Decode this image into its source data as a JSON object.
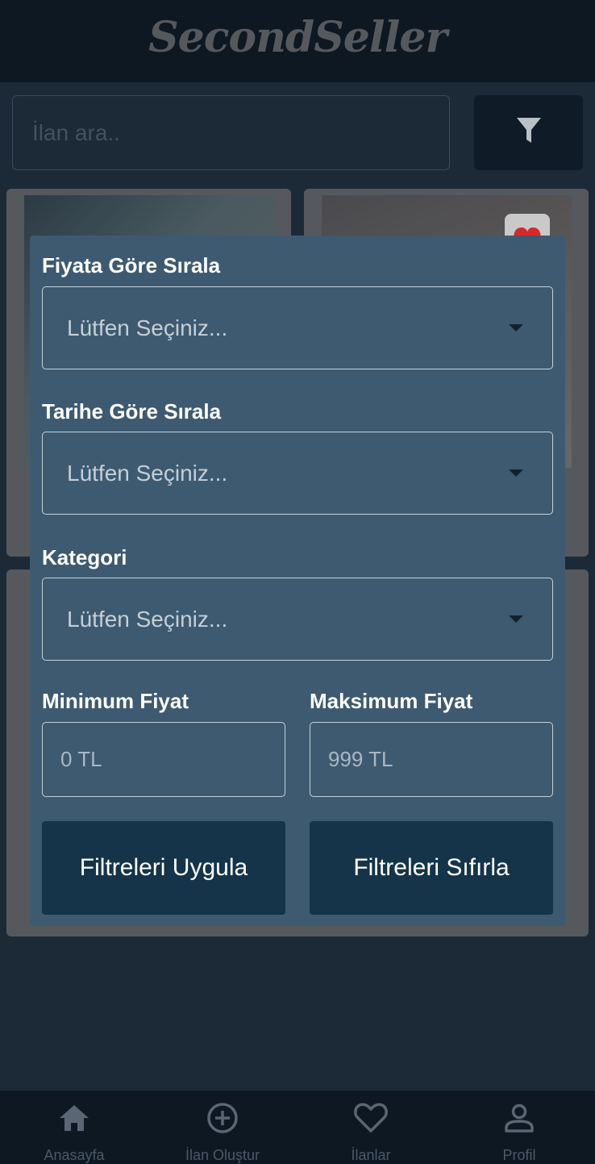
{
  "app": {
    "title": "SecondSeller"
  },
  "search": {
    "placeholder": "İlan ara.."
  },
  "icons": {
    "filter": "filter-icon",
    "heart": "heart-icon",
    "home": "home-icon",
    "add": "plus-circle-icon",
    "favorites": "heart-outline-icon",
    "profile": "user-icon"
  },
  "filter_modal": {
    "price_sort": {
      "label": "Fiyata Göre Sırala",
      "value": "Lütfen Seçiniz..."
    },
    "date_sort": {
      "label": "Tarihe Göre Sırala",
      "value": "Lütfen Seçiniz..."
    },
    "category": {
      "label": "Kategori",
      "value": "Lütfen Seçiniz..."
    },
    "min_price": {
      "label": "Minimum Fiyat",
      "placeholder": "0 TL"
    },
    "max_price": {
      "label": "Maksimum Fiyat",
      "placeholder": "999 TL"
    },
    "apply_button": "Filtreleri Uygula",
    "reset_button": "Filtreleri Sıfırla"
  },
  "bottom_nav": {
    "items": [
      {
        "label": "Anasayfa"
      },
      {
        "label": "İlan Oluştur"
      },
      {
        "label": "İlanlar"
      },
      {
        "label": "Profil"
      }
    ]
  },
  "colors": {
    "header_bg": "#0e1822",
    "page_bg": "#1c2a38",
    "modal_bg": "#3d5a70",
    "button_bg": "#15344a",
    "heart_red": "#d42a2a"
  }
}
